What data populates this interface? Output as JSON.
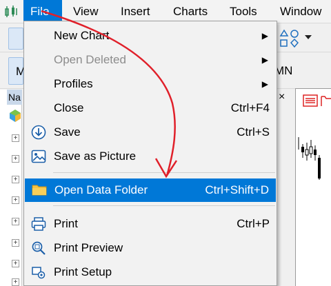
{
  "menubar": {
    "items": [
      {
        "label": "File",
        "active": true
      },
      {
        "label": "View"
      },
      {
        "label": "Insert"
      },
      {
        "label": "Charts"
      },
      {
        "label": "Tools"
      },
      {
        "label": "Window"
      }
    ]
  },
  "nav": {
    "title": "Na",
    "close": "×"
  },
  "toolbar2": {
    "partial_left": "M",
    "partial_right": "MN"
  },
  "file_menu": {
    "items": [
      {
        "label": "New Chart",
        "submenu": true,
        "icon": "none"
      },
      {
        "label": "Open Deleted",
        "submenu": true,
        "disabled": true,
        "icon": "none"
      },
      {
        "label": "Profiles",
        "submenu": true,
        "icon": "none"
      },
      {
        "label": "Close",
        "shortcut": "Ctrl+F4",
        "icon": "none"
      },
      {
        "label": "Save",
        "shortcut": "Ctrl+S",
        "icon": "save-icon"
      },
      {
        "label": "Save as Picture",
        "icon": "picture-icon"
      },
      {
        "label": "Open Data Folder",
        "shortcut": "Ctrl+Shift+D",
        "icon": "folder-icon",
        "highlighted": true
      },
      {
        "label": "Print",
        "shortcut": "Ctrl+P",
        "icon": "printer-icon"
      },
      {
        "label": "Print Preview",
        "icon": "print-preview-icon"
      },
      {
        "label": "Print Setup",
        "icon": "print-setup-icon"
      }
    ]
  },
  "colors": {
    "highlight": "#0078d7",
    "annotation_arrow": "#e0202a",
    "folder": "#f5c342"
  }
}
